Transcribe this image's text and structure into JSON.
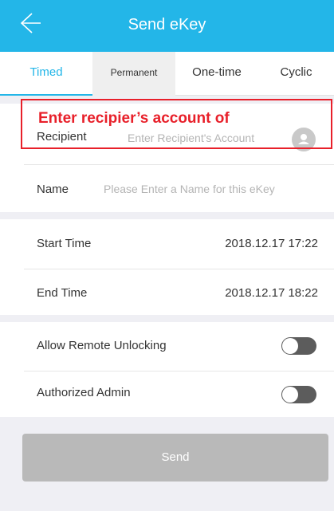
{
  "header": {
    "title": "Send eKey"
  },
  "tabs": [
    {
      "label": "Timed"
    },
    {
      "label": "Permanent"
    },
    {
      "label": "One-time"
    },
    {
      "label": "Cyclic"
    }
  ],
  "annotation": {
    "text": "Enter recipier’s account of"
  },
  "recipient": {
    "label": "Recipient",
    "placeholder": "Enter Recipient's Account"
  },
  "name": {
    "label": "Name",
    "placeholder": "Please Enter a Name for this eKey"
  },
  "times": {
    "start_label": "Start Time",
    "start_value": "2018.12.17 17:22",
    "end_label": "End Time",
    "end_value": "2018.12.17 18:22"
  },
  "options": {
    "remote_label": "Allow Remote Unlocking",
    "remote_on": false,
    "admin_label": "Authorized Admin",
    "admin_on": false
  },
  "send_label": "Send",
  "colors": {
    "accent": "#23b6e8",
    "annotation": "#e8202a",
    "button_disabled": "#b9b9b9"
  }
}
